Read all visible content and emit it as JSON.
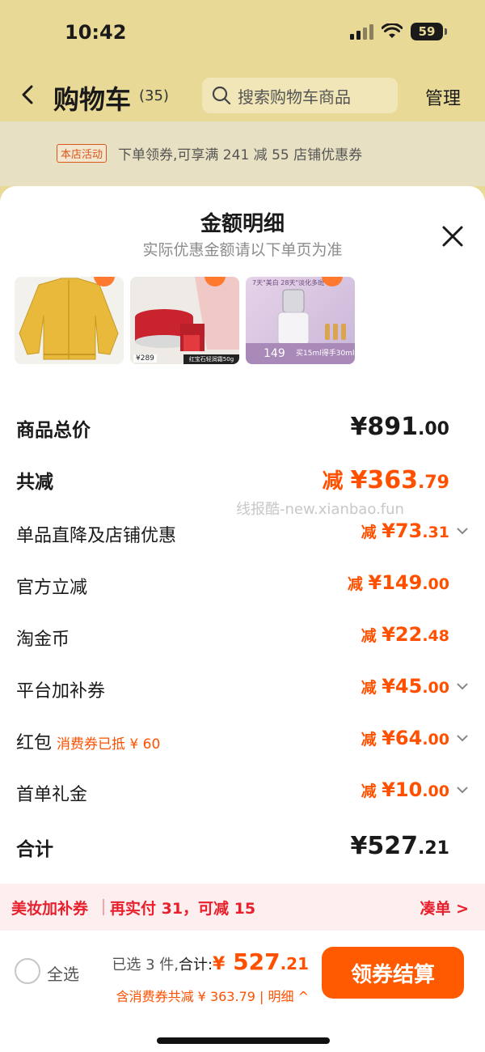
{
  "status_bar": {
    "time": "10:42",
    "battery": "59"
  },
  "nav": {
    "title": "购物车",
    "count": "(35)",
    "search_placeholder": "搜索购物车商品",
    "manage": "管理"
  },
  "promo": {
    "tag": "本店活动",
    "text": "下单领券,可享满 241 减 55 店铺优惠券"
  },
  "sheet": {
    "title": "金额明细",
    "subtitle": "实际优惠金额请以下单页为准"
  },
  "thumbnails": {
    "item2_price": "¥289",
    "item2_label": "红宝石轻润霜50g",
    "item3_top": "7天\"美白 28天\"淡化多斑",
    "item3_price": "149",
    "item3_note": "买15ml得手30ml"
  },
  "breakdown": {
    "total": {
      "label": "商品总价",
      "yen": "¥",
      "int": "891",
      "dec": ".00"
    },
    "discount": {
      "label": "共减",
      "prefix": "减 ",
      "yen": "¥",
      "int": "363",
      "dec": ".79"
    },
    "items": [
      {
        "label": "单品直降及店铺优惠",
        "prefix": "减 ",
        "yen": "¥",
        "int": "73",
        "dec": ".31",
        "expandable": true
      },
      {
        "label": "官方立减",
        "prefix": "减 ",
        "yen": "¥",
        "int": "149",
        "dec": ".00",
        "expandable": false
      },
      {
        "label": "淘金币",
        "prefix": "减 ",
        "yen": "¥",
        "int": "22",
        "dec": ".48",
        "expandable": false
      },
      {
        "label": "平台加补券",
        "prefix": "减 ",
        "yen": "¥",
        "int": "45",
        "dec": ".00",
        "expandable": true
      },
      {
        "label": "红包",
        "note": "消费券已抵 ¥ 60",
        "prefix": "减 ",
        "yen": "¥",
        "int": "64",
        "dec": ".00",
        "expandable": true
      },
      {
        "label": "首单礼金",
        "prefix": "减 ",
        "yen": "¥",
        "int": "10",
        "dec": ".00",
        "expandable": true
      }
    ],
    "sum": {
      "label": "合计",
      "yen": "¥",
      "int": "527",
      "dec": ".21"
    }
  },
  "watermark": "线报酷-new.xianbao.fun",
  "coupon_bar": {
    "title": "美妆加补券",
    "text": "再实付 31，可减 15",
    "link": "凑单 >"
  },
  "checkout": {
    "select_all": "全选",
    "selected": "已选 3 件,",
    "total_label": "合计:",
    "yen": "¥",
    "int": " 527",
    "dec": ".21",
    "line2": "含消费券共减 ¥ 363.79 | 明细 ^",
    "button": "领券结算"
  },
  "colors": {
    "accent": "#ff5000",
    "button": "#ff5a00",
    "coupon_red": "#e8202c",
    "background_app": "#e9d996"
  }
}
